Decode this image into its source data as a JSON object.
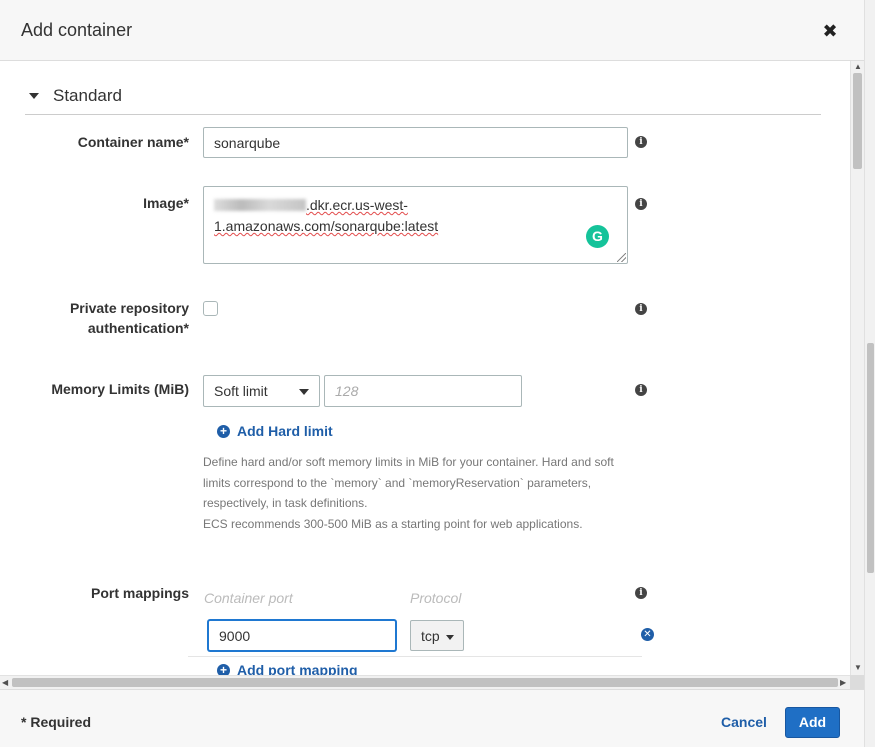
{
  "modal": {
    "title": "Add container",
    "close_glyph": "✖"
  },
  "section": {
    "title": "Standard"
  },
  "fields": {
    "container_name": {
      "label": "Container name*",
      "value": "sonarqube"
    },
    "image": {
      "label": "Image*",
      "value_visible": ".dkr.ecr.us-west-1.amazonaws.com/sonarqube:latest",
      "line1": ".dkr.ecr.us-west-",
      "line2": "1.amazonaws.com/sonarqube:latest"
    },
    "private_repo": {
      "label_line1": "Private repository",
      "label_line2": "authentication*",
      "checked": false
    },
    "memory": {
      "label": "Memory Limits (MiB)",
      "select_value": "Soft limit",
      "input_placeholder": "128",
      "add_hard_limit": "Add Hard limit",
      "help_line1": "Define hard and/or soft memory limits in MiB for your container. Hard and soft",
      "help_line2": "limits correspond to the `memory` and `memoryReservation` parameters,",
      "help_line3": "respectively, in task definitions.",
      "help_line4": "ECS recommends 300-500 MiB as a starting point for web applications."
    },
    "port_mappings": {
      "label": "Port mappings",
      "col_container_port": "Container port",
      "col_protocol": "Protocol",
      "rows": [
        {
          "container_port": "9000",
          "protocol": "tcp"
        }
      ],
      "add_port_mapping": "Add port mapping"
    }
  },
  "icons": {
    "info": "info-icon",
    "plus": "plus-circle-icon",
    "remove": "remove-circle-icon",
    "grammarly": "grammarly-icon"
  },
  "footer": {
    "required_note": "* Required",
    "cancel_label": "Cancel",
    "add_label": "Add"
  },
  "colors": {
    "link": "#1f5ea8",
    "primary_button": "#1f6fc5",
    "grammarly": "#15c39a"
  }
}
